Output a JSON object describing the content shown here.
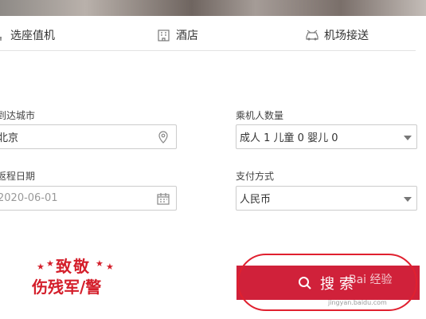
{
  "tabs": [
    {
      "label": "选座值机",
      "icon": "seat-icon"
    },
    {
      "label": "酒店",
      "icon": "hotel-icon"
    },
    {
      "label": "机场接送",
      "icon": "car-icon"
    }
  ],
  "form": {
    "arrival_city_label": "到达城市",
    "arrival_city_value": "北京",
    "passengers_label": "乘机人数量",
    "passengers_value": "成人 1  儿童 0  婴儿 0",
    "return_date_label": "返程日期",
    "return_date_value": "2020-06-01",
    "payment_label": "支付方式",
    "payment_value": "人民币"
  },
  "search_label": "搜索",
  "tribute": {
    "line1": "致敬",
    "line2": "伤残军/警"
  },
  "watermark": "Bai  经验",
  "watermark_url": "jingyan.baidu.com",
  "colors": {
    "accent": "#d0213a",
    "border": "#cccccc"
  }
}
